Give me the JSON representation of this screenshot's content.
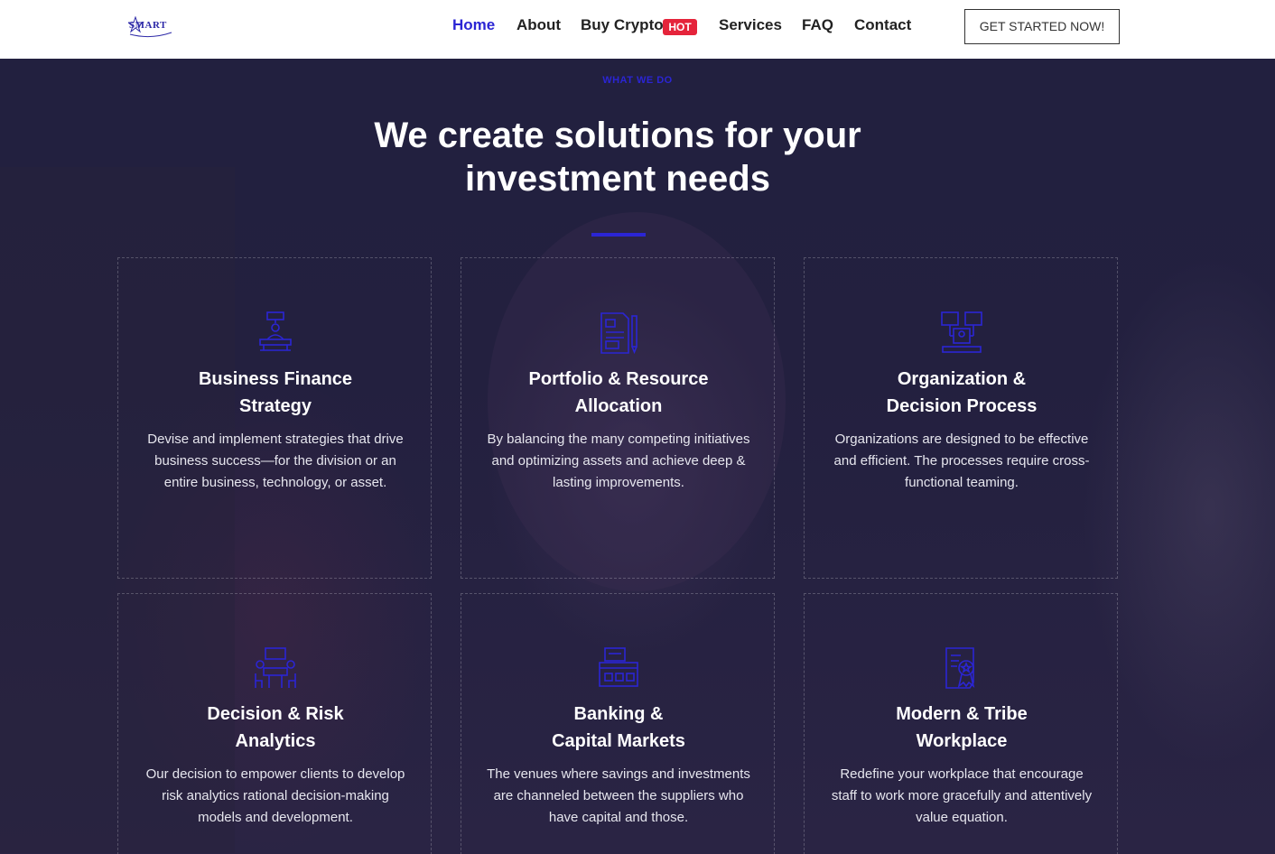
{
  "header": {
    "logo_text": "SMART",
    "nav": [
      "Home",
      "About",
      "Buy Crypto",
      "Services",
      "FAQ",
      "Contact"
    ],
    "hot_badge": "HOT",
    "cta": "GET STARTED NOW!"
  },
  "hero": {
    "eyebrow": "WHAT WE DO",
    "headline_line1": "We create solutions for your",
    "headline_line2": "investment needs"
  },
  "cards": [
    {
      "title_line1": "Business Finance",
      "title_line2": "Strategy",
      "text": "Devise and implement strategies that drive business success—for the division or an entire business, technology, or asset.",
      "icon": "presentation-desk-icon"
    },
    {
      "title_line1": "Portfolio & Resource",
      "title_line2": "Allocation",
      "text": "By balancing the many competing initiatives and optimizing assets and achieve deep & lasting improvements.",
      "icon": "document-pen-icon"
    },
    {
      "title_line1": "Organization &",
      "title_line2": "Decision Process",
      "text": "Organizations are designed to be effective and efficient. The processes require cross-functional teaming.",
      "icon": "org-chart-icon"
    },
    {
      "title_line1": "Decision & Risk",
      "title_line2": "Analytics",
      "text": "Our decision to empower clients to develop risk analytics rational decision-making models and development.",
      "icon": "meeting-table-icon"
    },
    {
      "title_line1": "Banking &",
      "title_line2": "Capital Markets",
      "text": "The venues where savings and investments are channeled between the suppliers who have capital and those.",
      "icon": "banking-cards-icon"
    },
    {
      "title_line1": "Modern & Tribe",
      "title_line2": "Workplace",
      "text": "Redefine your workplace that encourage staff to work more gracefully and attentively value equation.",
      "icon": "certificate-award-icon"
    }
  ],
  "colors": {
    "accent": "#2b25d4",
    "hot": "#e5243b",
    "overlay": "#22203f"
  }
}
